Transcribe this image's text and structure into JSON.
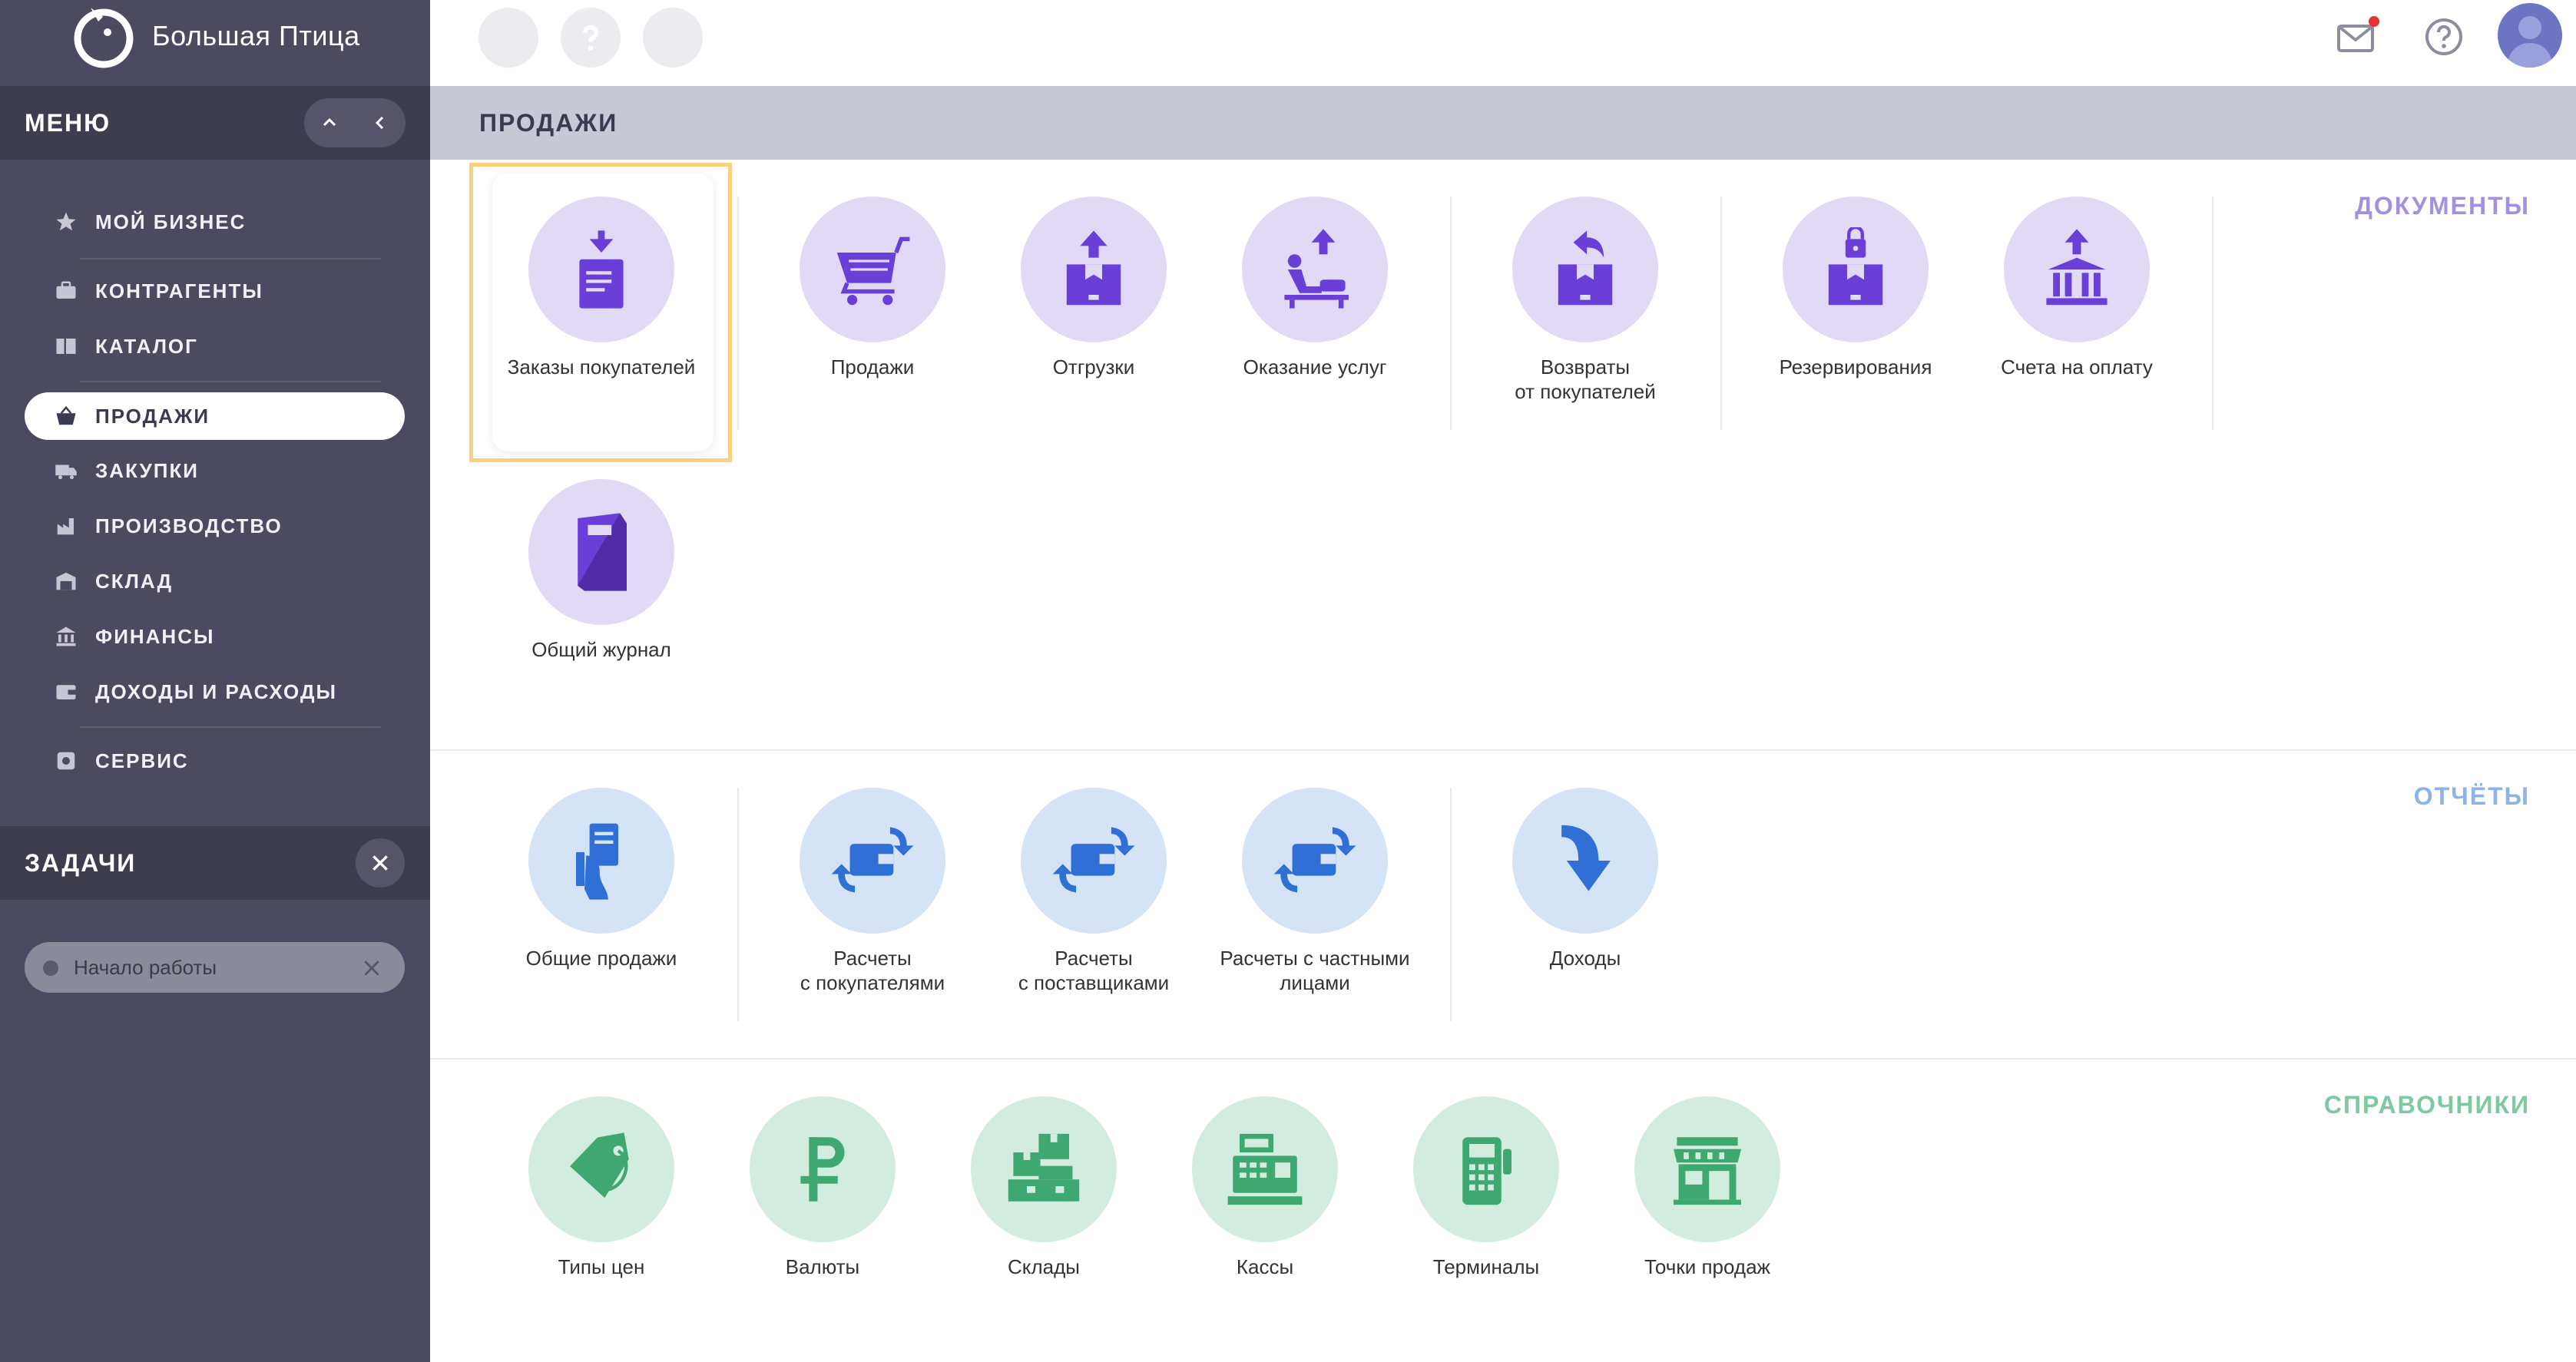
{
  "app": {
    "name": "Большая Птица"
  },
  "sidebar": {
    "menu_title": "МЕНЮ",
    "items": [
      {
        "label": "МОЙ БИЗНЕС",
        "icon": "star-icon"
      },
      {
        "label": "КОНТРАГЕНТЫ",
        "icon": "briefcase-icon"
      },
      {
        "label": "КАТАЛОГ",
        "icon": "book-icon"
      },
      {
        "label": "ПРОДАЖИ",
        "icon": "basket-icon",
        "active": true
      },
      {
        "label": "ЗАКУПКИ",
        "icon": "truck-icon"
      },
      {
        "label": "ПРОИЗВОДСТВО",
        "icon": "factory-icon"
      },
      {
        "label": "СКЛАД",
        "icon": "warehouse-icon"
      },
      {
        "label": "ФИНАНСЫ",
        "icon": "bank-icon"
      },
      {
        "label": "ДОХОДЫ И РАСХОДЫ",
        "icon": "wallet-icon"
      },
      {
        "label": "СЕРВИС",
        "icon": "gear-icon"
      }
    ],
    "tasks_title": "ЗАДАЧИ",
    "task_chip": "Начало работы"
  },
  "header": {
    "section_title": "ПРОДАЖИ"
  },
  "groups": {
    "documents": {
      "label": "ДОКУМЕНТЫ",
      "color": "#a48fe0",
      "tiles": [
        {
          "label": "Заказы покупателей",
          "icon": "order-doc-icon"
        },
        {
          "label": "Продажи",
          "icon": "cart-icon"
        },
        {
          "label": "Отгрузки",
          "icon": "shipment-box-icon"
        },
        {
          "label": "Оказание услуг",
          "icon": "service-icon"
        },
        {
          "label": "Возвраты\nот покупателей",
          "icon": "return-box-icon"
        },
        {
          "label": "Резервирования",
          "icon": "reserve-lock-icon"
        },
        {
          "label": "Счета на оплату",
          "icon": "invoice-bank-icon"
        },
        {
          "label": "Общий журнал",
          "icon": "journal-icon"
        }
      ]
    },
    "reports": {
      "label": "ОТЧЁТЫ",
      "color": "#8db3e8",
      "tiles": [
        {
          "label": "Общие продажи",
          "icon": "receipt-hand-icon"
        },
        {
          "label": "Расчеты\nс покупателями",
          "icon": "wallet-exchange-icon"
        },
        {
          "label": "Расчеты\nс поставщиками",
          "icon": "wallet-exchange-icon"
        },
        {
          "label": "Расчеты с частными\nлицами",
          "icon": "wallet-exchange-icon"
        },
        {
          "label": "Доходы",
          "icon": "income-arrow-icon"
        }
      ]
    },
    "references": {
      "label": "СПРАВОЧНИКИ",
      "color": "#7ccaa0",
      "tiles": [
        {
          "label": "Типы цен",
          "icon": "price-tag-icon"
        },
        {
          "label": "Валюты",
          "icon": "ruble-icon"
        },
        {
          "label": "Склады",
          "icon": "boxes-icon"
        },
        {
          "label": "Кассы",
          "icon": "cash-register-icon"
        },
        {
          "label": "Терминалы",
          "icon": "terminal-icon"
        },
        {
          "label": "Точки продаж",
          "icon": "storefront-icon"
        }
      ]
    }
  }
}
